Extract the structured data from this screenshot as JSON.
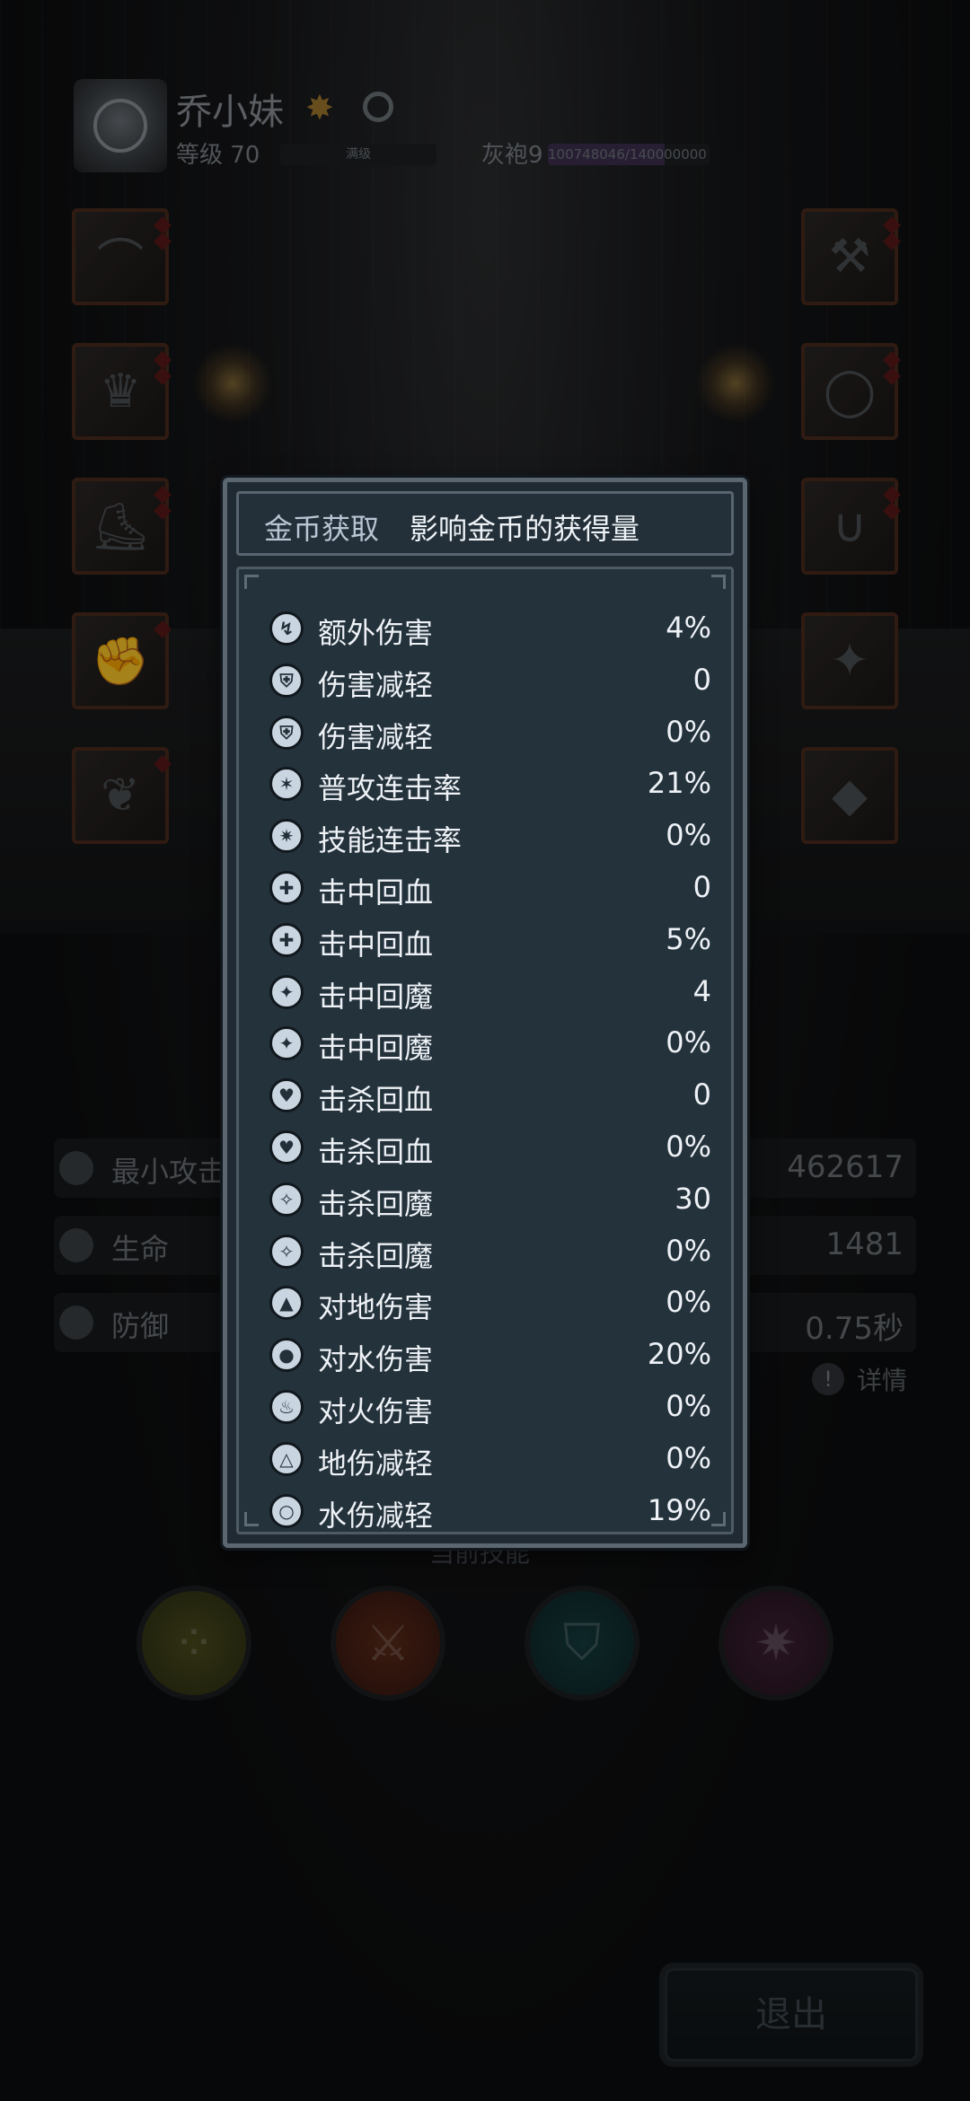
{
  "player": {
    "name": "乔小妹",
    "level_label": "等级 70",
    "level_status": "满级",
    "rank_label": "灰袍9",
    "exp_text": "100748046/140000000",
    "exp_fraction": 0.7196
  },
  "stats": [
    {
      "label": "最小攻击",
      "value": "462617"
    },
    {
      "label": "生命",
      "value": "1481"
    },
    {
      "label": "防御",
      "value": "0.75秒"
    }
  ],
  "detail_link": "详情",
  "skills_section_title": "当前技能",
  "exit_label": "退出",
  "modal": {
    "title": "金币获取",
    "description": "影响金币的获得量",
    "attributes": [
      {
        "icon": "extra-damage-icon",
        "label": "额外伤害",
        "value": "4%"
      },
      {
        "icon": "damage-reduction-icon",
        "label": "伤害减轻",
        "value": "0"
      },
      {
        "icon": "damage-reduction-percent-icon",
        "label": "伤害减轻",
        "value": "0%"
      },
      {
        "icon": "attack-combo-icon",
        "label": "普攻连击率",
        "value": "21%"
      },
      {
        "icon": "skill-combo-icon",
        "label": "技能连击率",
        "value": "0%"
      },
      {
        "icon": "hit-heal-icon",
        "label": "击中回血",
        "value": "0"
      },
      {
        "icon": "hit-heal-percent-icon",
        "label": "击中回血",
        "value": "5%"
      },
      {
        "icon": "hit-mana-icon",
        "label": "击中回魔",
        "value": "4"
      },
      {
        "icon": "hit-mana-percent-icon",
        "label": "击中回魔",
        "value": "0%"
      },
      {
        "icon": "kill-heal-icon",
        "label": "击杀回血",
        "value": "0"
      },
      {
        "icon": "kill-heal-percent-icon",
        "label": "击杀回血",
        "value": "0%"
      },
      {
        "icon": "kill-mana-icon",
        "label": "击杀回魔",
        "value": "30"
      },
      {
        "icon": "kill-mana-percent-icon",
        "label": "击杀回魔",
        "value": "0%"
      },
      {
        "icon": "earth-damage-icon",
        "label": "对地伤害",
        "value": "0%"
      },
      {
        "icon": "water-damage-icon",
        "label": "对水伤害",
        "value": "20%"
      },
      {
        "icon": "fire-damage-icon",
        "label": "对火伤害",
        "value": "0%"
      },
      {
        "icon": "earth-reduction-icon",
        "label": "地伤减轻",
        "value": "0%"
      },
      {
        "icon": "water-reduction-icon",
        "label": "水伤减轻",
        "value": "19%"
      }
    ]
  },
  "colors": {
    "modal_bg": "#1f2a33",
    "modal_border": "#5a6670",
    "text": "#eef2f6",
    "title_text": "#b8c6d4"
  }
}
